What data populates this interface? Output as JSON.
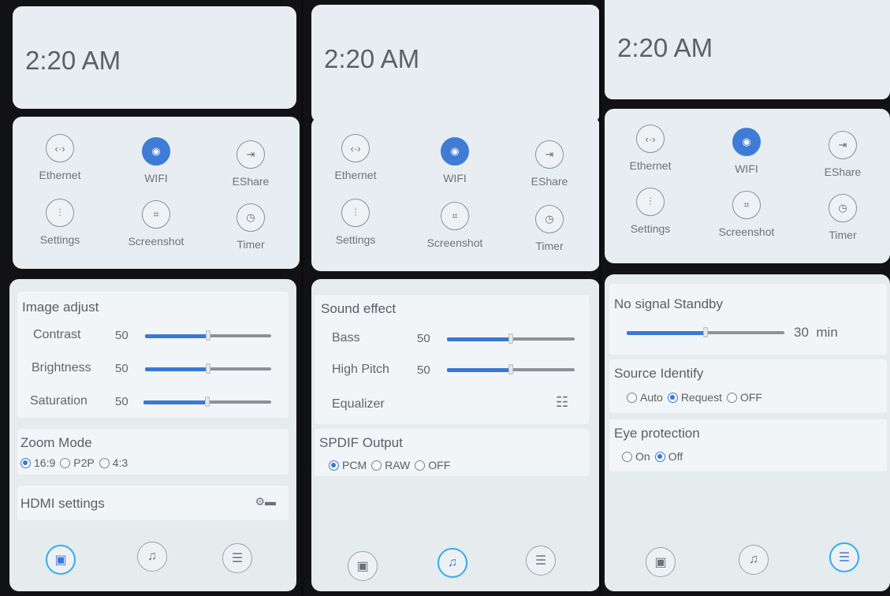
{
  "panels": [
    {
      "time": "2:20 AM",
      "quick": [
        {
          "label": "Ethernet",
          "icon": "ethernet-icon",
          "glyph": "‹·›"
        },
        {
          "label": "WIFI",
          "icon": "wifi-icon",
          "glyph": "◉",
          "active": true
        },
        {
          "label": "EShare",
          "icon": "eshare-icon",
          "glyph": "⇥"
        },
        {
          "label": "Settings",
          "icon": "settings-sliders-icon",
          "glyph": "⫶"
        },
        {
          "label": "Screenshot",
          "icon": "screenshot-icon",
          "glyph": "⌗"
        },
        {
          "label": "Timer",
          "icon": "clock-icon",
          "glyph": "◷"
        }
      ],
      "image": {
        "title": "Image adjust",
        "contrast": {
          "label": "Contrast",
          "value": "50"
        },
        "brightness": {
          "label": "Brightness",
          "value": "50"
        },
        "saturation": {
          "label": "Saturation",
          "value": "50"
        }
      },
      "zoom": {
        "title": "Zoom Mode",
        "options": [
          "16:9",
          "P2P",
          "4:3"
        ],
        "selected": "16:9"
      },
      "hdmi": {
        "label": "HDMI settings"
      }
    },
    {
      "time": "2:20 AM",
      "quick": [
        {
          "label": "Ethernet"
        },
        {
          "label": "WIFI"
        },
        {
          "label": "EShare"
        },
        {
          "label": "Settings"
        },
        {
          "label": "Screenshot"
        },
        {
          "label": "Timer"
        }
      ],
      "sound": {
        "title": "Sound effect",
        "bass": {
          "label": "Bass",
          "value": "50"
        },
        "high": {
          "label": "High Pitch",
          "value": "50"
        },
        "eq": {
          "label": "Equalizer"
        }
      },
      "spdif": {
        "title": "SPDIF Output",
        "options": [
          "PCM",
          "RAW",
          "OFF"
        ],
        "selected": "PCM"
      }
    },
    {
      "time": "2:20 AM",
      "quick": [
        {
          "label": "Ethernet"
        },
        {
          "label": "WIFI"
        },
        {
          "label": "EShare"
        },
        {
          "label": "Settings"
        },
        {
          "label": "Screenshot"
        },
        {
          "label": "Timer"
        }
      ],
      "standby": {
        "title": "No signal Standby",
        "value": "30",
        "unit": "min",
        "level": 0.5
      },
      "source": {
        "title": "Source Identify",
        "options": [
          "Auto",
          "Request",
          "OFF"
        ],
        "selected": "Request"
      },
      "eye": {
        "title": "Eye protection",
        "options": [
          "On",
          "Off"
        ],
        "selected": "Off"
      }
    }
  ],
  "slider_level": 0.5,
  "colors": {
    "accent": "#3a78d6",
    "wifi_active": "#3f7cd6",
    "tab_active": "#3fa8e6"
  }
}
